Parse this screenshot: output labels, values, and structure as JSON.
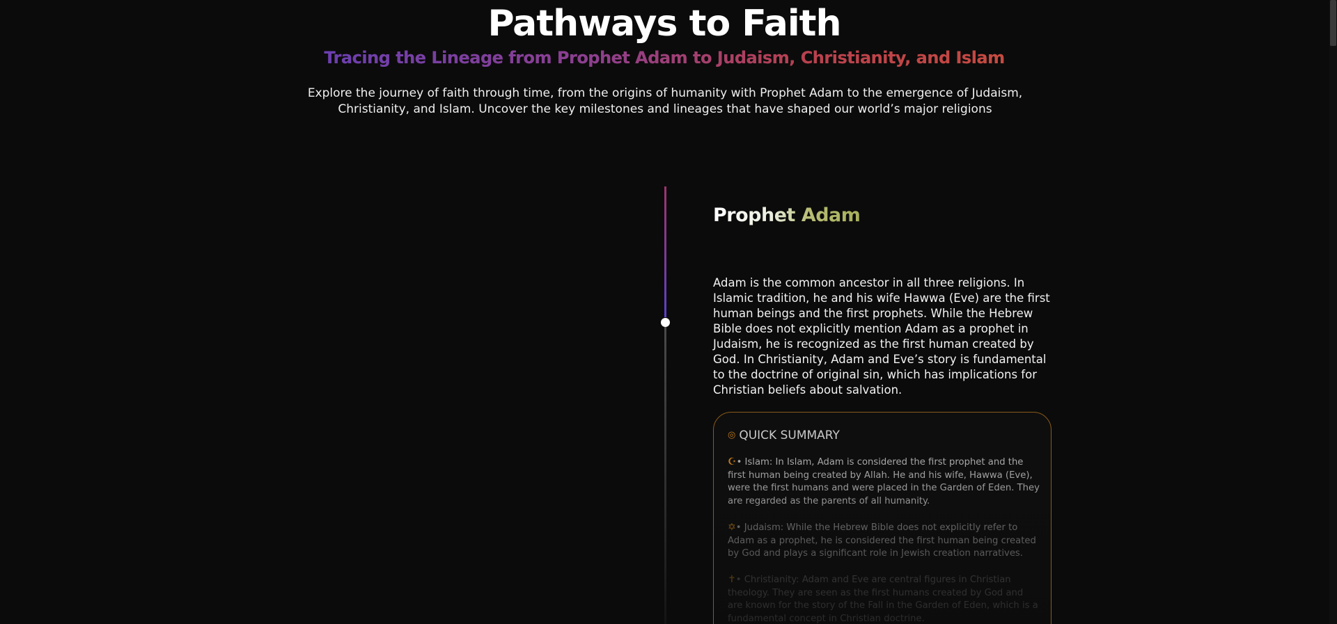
{
  "hero": {
    "title": "Pathways to Faith",
    "subtitle": "Tracing the Lineage from Prophet Adam to Judaism, Christianity, and Islam",
    "intro": "Explore the journey of faith through time, from the origins of humanity with Prophet Adam to the emergence of Judaism, Christianity, and Islam. Uncover the key milestones and lineages that have shaped our world’s major religions"
  },
  "timeline": {
    "entry": {
      "title": "Prophet Adam",
      "body": "Adam is the common ancestor in all three religions. In Islamic tradition, he and his wife Hawwa (Eve) are the first human beings and the first prophets. While the Hebrew Bible does not explicitly mention Adam as a prophet in Judaism, he is recognized as the first human created by God. In Christianity, Adam and Eve’s story is fundamental to the doctrine of original sin, which has implications for Christian beliefs about salvation."
    }
  },
  "summary": {
    "heading": "QUICK SUMMARY",
    "heading_icon": "target-icon",
    "items": [
      {
        "icon": "☪",
        "icon_name": "crescent-icon",
        "text": "• Islam: In Islam, Adam is considered the first prophet and the first human being created by Allah. He and his wife, Hawwa (Eve), were the first humans and were placed in the Garden of Eden. They are regarded as the parents of all humanity."
      },
      {
        "icon": "✡",
        "icon_name": "star-of-david-icon",
        "text": "• Judaism: While the Hebrew Bible does not explicitly refer to Adam as a prophet, he is considered the first human being created by God and plays a significant role in Jewish creation narratives."
      },
      {
        "icon": "✝",
        "icon_name": "cross-icon",
        "text": "• Christianity: Adam and Eve are central figures in Christian theology. They are seen as the first humans created by God and are known for the story of the Fall in the Garden of Eden, which is a fundamental concept in Christian doctrine."
      }
    ]
  },
  "colors": {
    "background": "#0b0b0b",
    "accent_gold": "#c07a1c",
    "subtitle_gradient_start": "#6a3fb0",
    "subtitle_gradient_end": "#c64a3f",
    "entry_title_accent": "#a6b05a"
  }
}
